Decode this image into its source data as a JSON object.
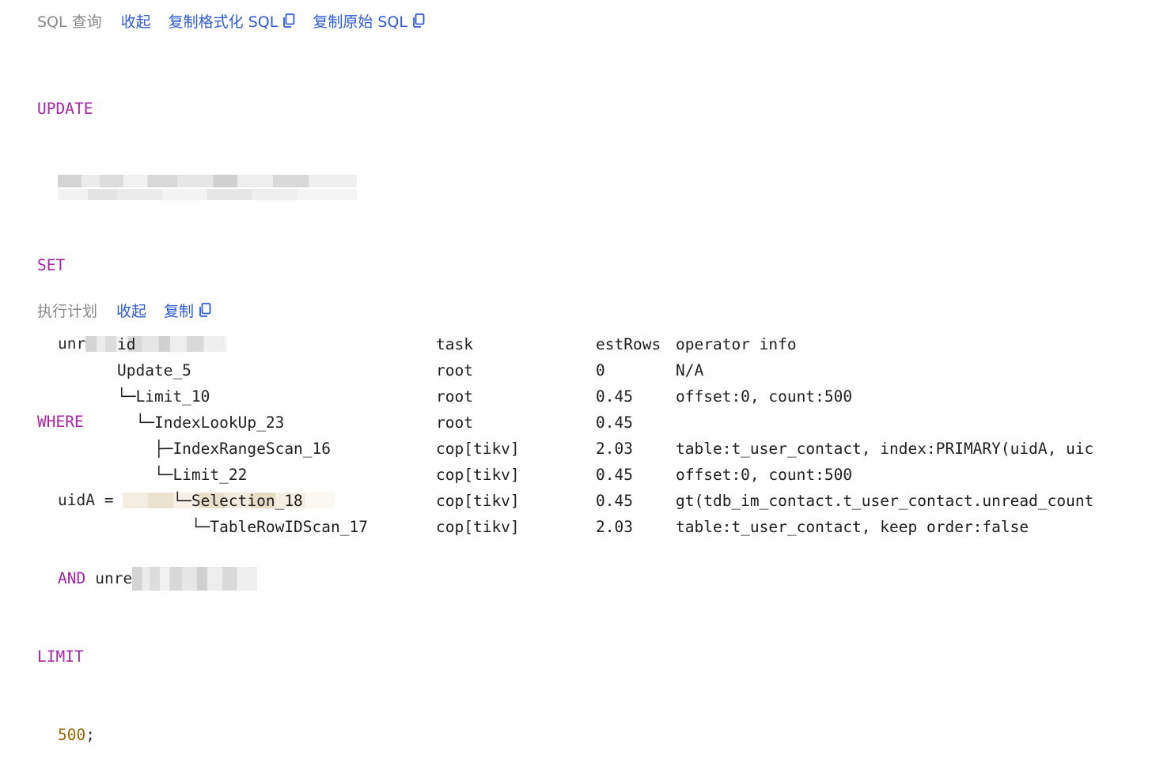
{
  "sql_section": {
    "label": "SQL 查询",
    "collapse": "收起",
    "copy_formatted": "复制格式化 SQL",
    "copy_raw": "复制原始 SQL",
    "copy_icon": "copy-icon",
    "lines": {
      "update_kw": "UPDATE",
      "set_kw": "SET",
      "set_prefix": "unr",
      "where_kw": "WHERE",
      "where_prefix": "uidA =",
      "and_kw": "AND",
      "and_prefix": "unre",
      "limit_kw": "LIMIT",
      "limit_value": "500",
      "terminator": ";"
    }
  },
  "plan_section": {
    "label": "执行计划",
    "collapse": "收起",
    "copy": "复制",
    "copy_icon": "copy-icon",
    "columns": {
      "id": "id",
      "task": "task",
      "est_rows": "estRows",
      "operator_info": "operator info"
    },
    "rows": [
      {
        "id": "Update_5",
        "task": "root",
        "est_rows": "0",
        "operator_info": "N/A"
      },
      {
        "id": "└─Limit_10",
        "task": "root",
        "est_rows": "0.45",
        "operator_info": "offset:0, count:500"
      },
      {
        "id": "  └─IndexLookUp_23",
        "task": "root",
        "est_rows": "0.45",
        "operator_info": ""
      },
      {
        "id": "    ├─IndexRangeScan_16",
        "task": "cop[tikv]",
        "est_rows": "2.03",
        "operator_info": "table:t_user_contact, index:PRIMARY(uidA, uic"
      },
      {
        "id": "    └─Limit_22",
        "task": "cop[tikv]",
        "est_rows": "0.45",
        "operator_info": "offset:0, count:500"
      },
      {
        "id": "      └─Selection_18",
        "task": "cop[tikv]",
        "est_rows": "0.45",
        "operator_info": "gt(tdb_im_contact.t_user_contact.unread_count"
      },
      {
        "id": "        └─TableRowIDScan_17",
        "task": "cop[tikv]",
        "est_rows": "2.03",
        "operator_info": "table:t_user_contact, keep order:false"
      }
    ]
  },
  "colors": {
    "link": "#2e5bd6",
    "label": "#8a8a8a",
    "keyword": "#a626a4",
    "number": "#986801"
  }
}
